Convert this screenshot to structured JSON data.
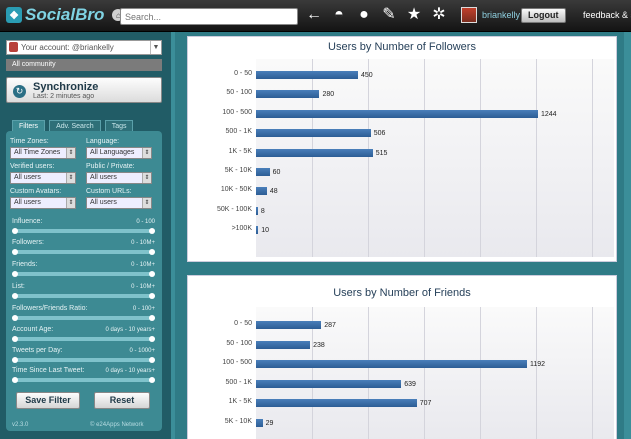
{
  "topbar": {
    "brand": "SocialBro",
    "search_placeholder": "Search...",
    "nav_icons": [
      "arrow-left-icon",
      "dashboard-icon",
      "chat-icon",
      "tools-icon",
      "star-icon",
      "gear-icon"
    ],
    "username": "briankelly ▾",
    "logout_label": "Logout",
    "feedback_label": "feedback & sup"
  },
  "sidebar": {
    "account": "Your account: @briankelly",
    "community": "All community",
    "sync_title": "Synchronize",
    "sync_sub": "Last: 2 minutes ago",
    "tabs": [
      {
        "label": "Filters"
      },
      {
        "label": "Adv. Search"
      },
      {
        "label": "Tags"
      }
    ],
    "filters": {
      "timezones_label": "Time Zones:",
      "timezones_value": "All Time Zones",
      "language_label": "Language:",
      "language_value": "All Languages",
      "verified_label": "Verified users:",
      "verified_value": "All users",
      "public_label": "Public / Private:",
      "public_value": "All users",
      "avatars_label": "Custom Avatars:",
      "avatars_value": "All users",
      "urls_label": "Custom URLs:",
      "urls_value": "All users"
    },
    "sliders": [
      {
        "label": "Influence:",
        "range": "0 - 100"
      },
      {
        "label": "Followers:",
        "range": "0 - 10M+"
      },
      {
        "label": "Friends:",
        "range": "0 - 10M+"
      },
      {
        "label": "List:",
        "range": "0 - 10M+"
      },
      {
        "label": "Followers/Friends Ratio:",
        "range": "0 - 100+"
      },
      {
        "label": "Account Age:",
        "range": "0 days - 10 years+"
      },
      {
        "label": "Tweets per Day:",
        "range": "0 - 1000+"
      },
      {
        "label": "Time Since Last Tweet:",
        "range": "0 days - 10 years+"
      }
    ],
    "save_label": "Save Filter",
    "reset_label": "Reset",
    "version": "v2.3.0",
    "copyright": "© e24Apps Network"
  },
  "colors": {
    "accent": "#2f7b86",
    "bar": "#3a6ea8",
    "sidebar_bg": "#215c66"
  },
  "chart_data": [
    {
      "type": "bar",
      "title": "Users by Number of Followers",
      "orientation": "horizontal",
      "categories": [
        "0 - 50",
        "50 - 100",
        "100 - 500",
        "500 - 1K",
        "1K - 5K",
        "5K - 10K",
        "10K - 50K",
        "50K - 100K",
        ">100K"
      ],
      "values": [
        450,
        280,
        1244,
        506,
        515,
        60,
        48,
        8,
        10
      ],
      "grid": true
    },
    {
      "type": "bar",
      "title": "Users by Number of Friends",
      "orientation": "horizontal",
      "categories": [
        "0 - 50",
        "50 - 100",
        "100 - 500",
        "500 - 1K",
        "1K - 5K",
        "5K - 10K"
      ],
      "values": [
        287,
        238,
        1192,
        639,
        707,
        29
      ],
      "grid": true
    }
  ]
}
